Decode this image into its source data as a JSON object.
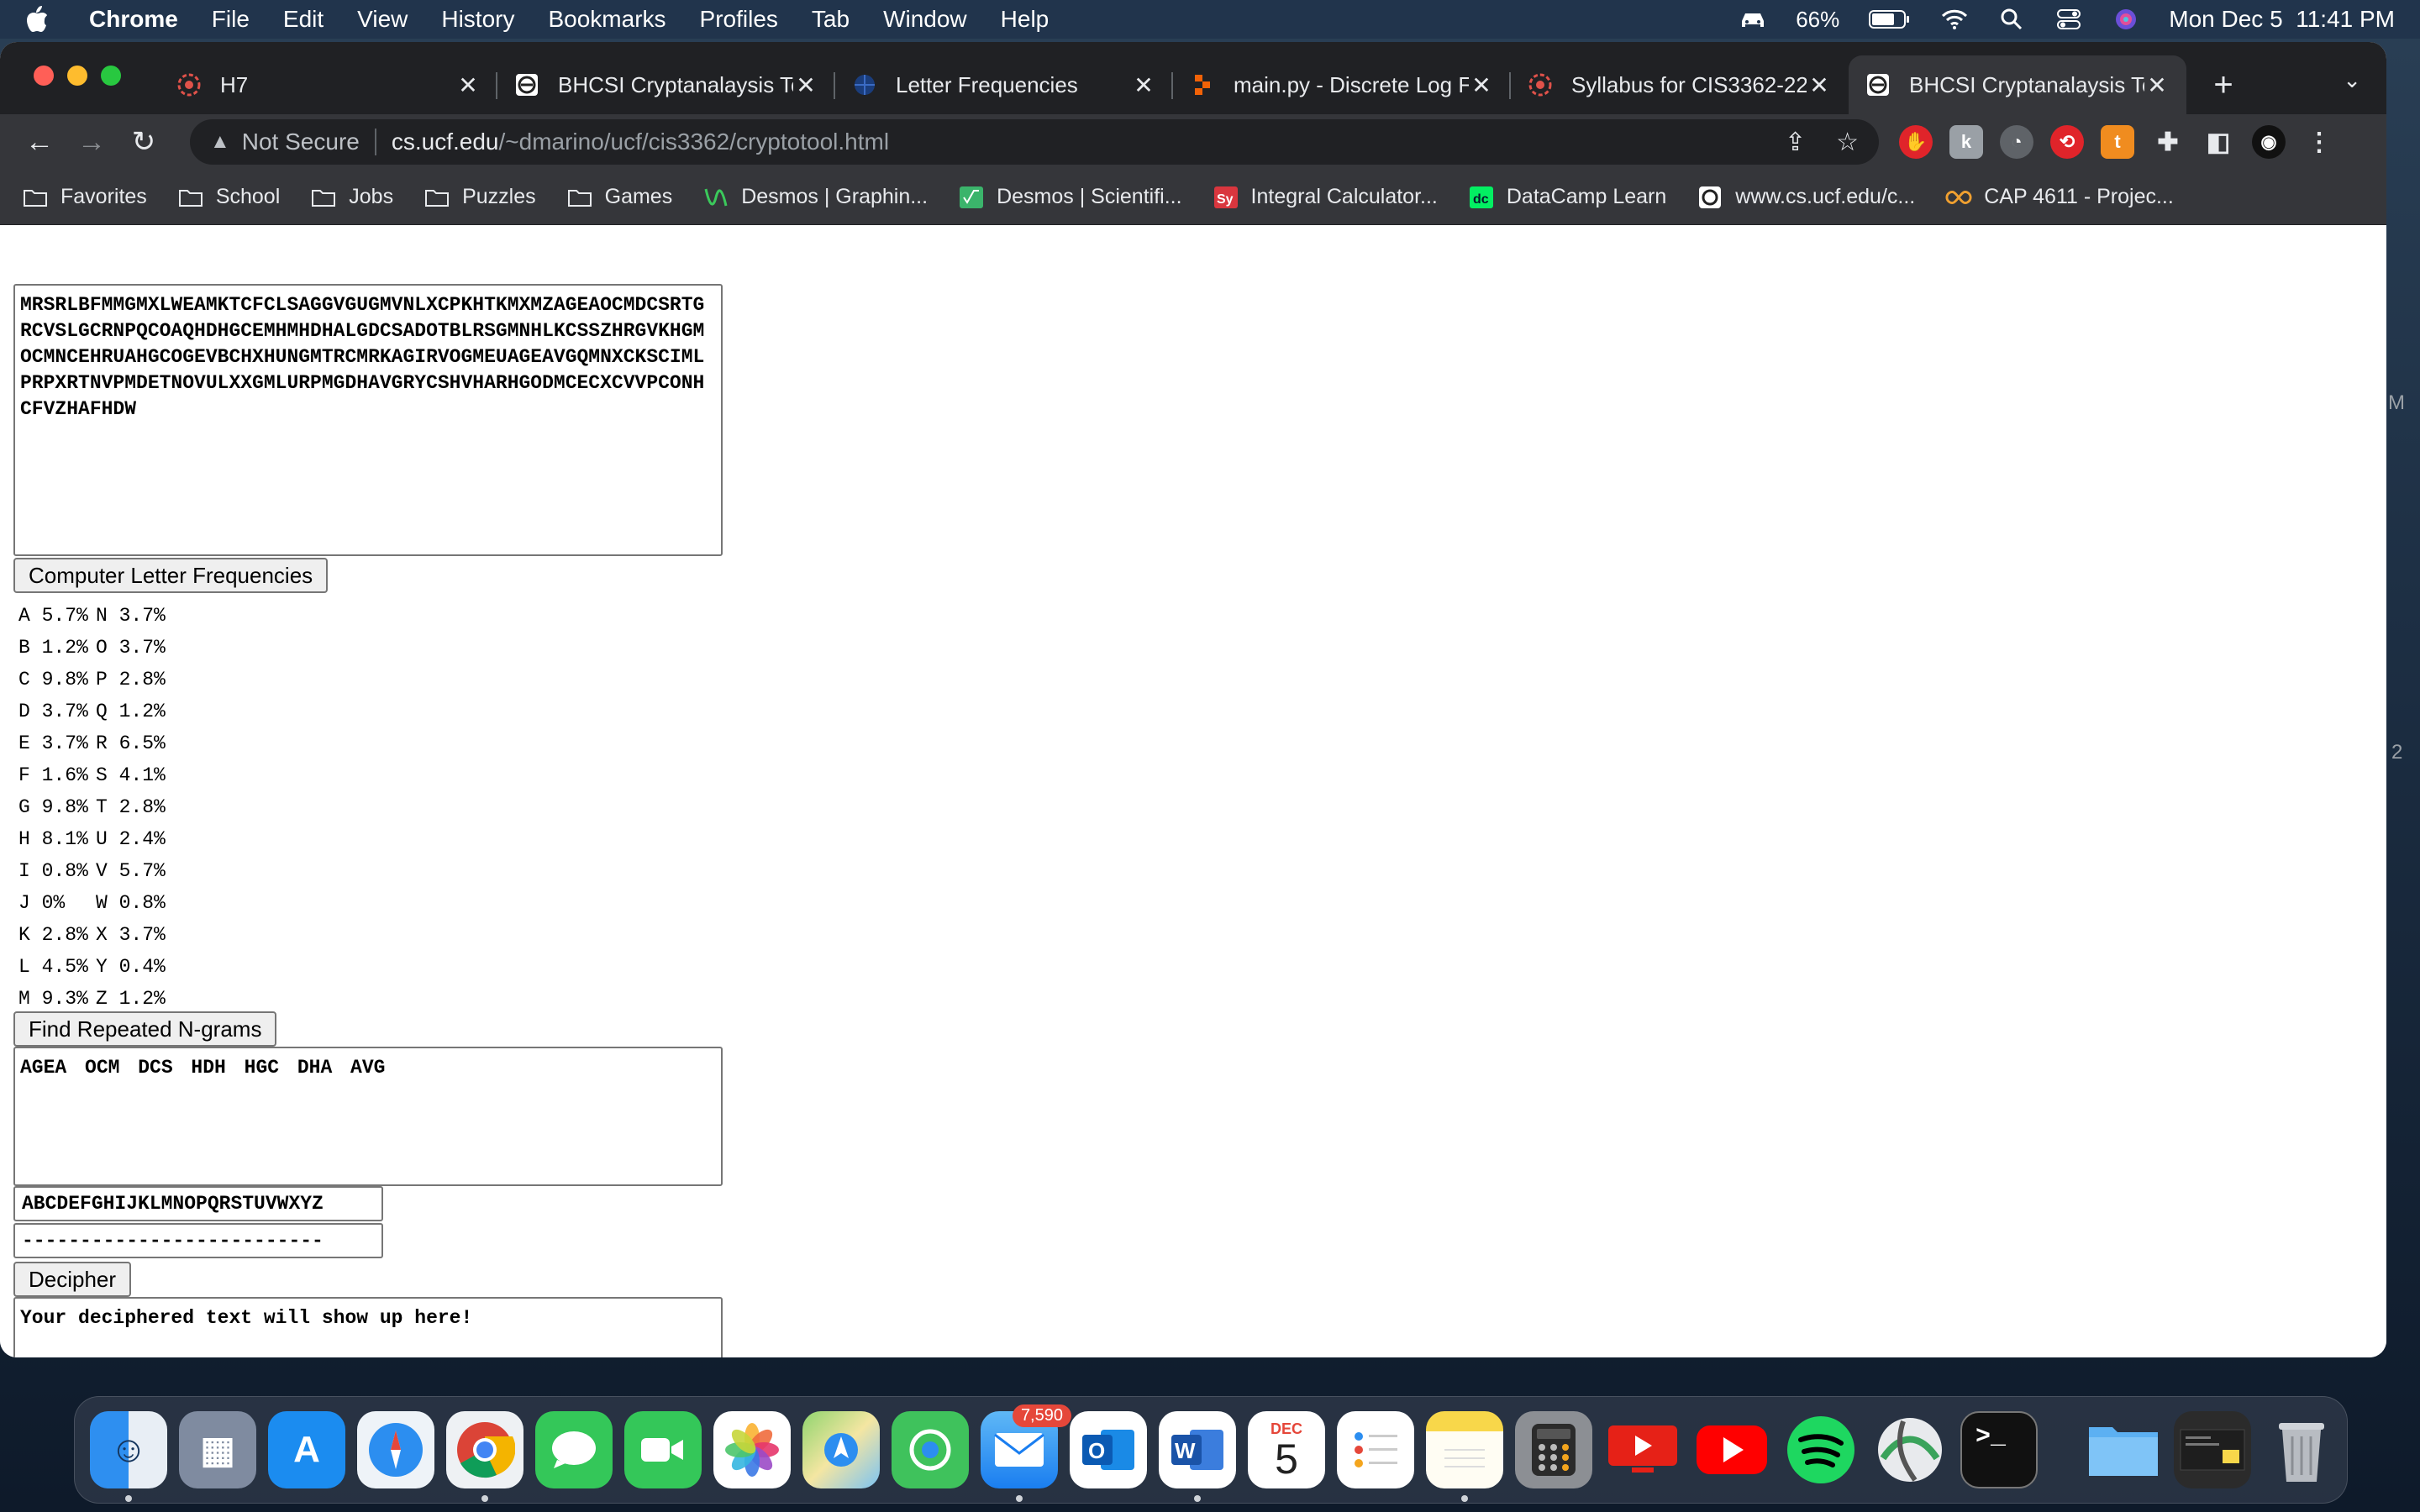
{
  "menubar": {
    "app_name": "Chrome",
    "items": [
      "File",
      "Edit",
      "View",
      "History",
      "Bookmarks",
      "Profiles",
      "Tab",
      "Window",
      "Help"
    ],
    "battery": "66%",
    "datetime": "Mon Dec 5  11:41 PM"
  },
  "tabs": [
    {
      "title": "H7",
      "icon": "ucf-icon"
    },
    {
      "title": "BHCSI Cryptanalaysis To",
      "icon": "cs-ucf-icon"
    },
    {
      "title": "Letter Frequencies",
      "icon": "globe-icon"
    },
    {
      "title": "main.py - Discrete Log F",
      "icon": "replit-icon"
    },
    {
      "title": "Syllabus for CIS3362-22",
      "icon": "ucf-icon"
    },
    {
      "title": "BHCSI Cryptanalaysis To",
      "icon": "cs-ucf-icon",
      "active": true
    }
  ],
  "omnibox": {
    "security": "Not Secure",
    "host": "cs.ucf.edu",
    "path": "/~dmarino/ucf/cis3362/cryptotool.html"
  },
  "bookmarks": [
    {
      "label": "Favorites",
      "icon": "folder-icon"
    },
    {
      "label": "School",
      "icon": "folder-icon"
    },
    {
      "label": "Jobs",
      "icon": "folder-icon"
    },
    {
      "label": "Puzzles",
      "icon": "folder-icon"
    },
    {
      "label": "Games",
      "icon": "folder-icon"
    },
    {
      "label": "Desmos | Graphin...",
      "icon": "desmos-graph-icon"
    },
    {
      "label": "Desmos | Scientifi...",
      "icon": "desmos-sci-icon"
    },
    {
      "label": "Integral Calculator...",
      "icon": "symbolab-icon"
    },
    {
      "label": "DataCamp Learn",
      "icon": "datacamp-icon"
    },
    {
      "label": "www.cs.ucf.edu/c...",
      "icon": "cs-ucf-icon"
    },
    {
      "label": "CAP 4611 - Projec...",
      "icon": "infinity-icon"
    }
  ],
  "tool": {
    "cipher_text": "MRSRLBFMMGMXLWEAMKTCFCLSAGGVGUGMVNLXCPKHTKMXMZAGEAOCMDCSRTGRCVSLGCRNPQCOAQHDHGCEMHMHDHALGDCSADOTBLRSGMNHLKCSSZHRGVKHGMOCMNCEHRUAHGCOGEVBCHXHUNGMTRCMRKAGIRVOGMEUAGEAVGQMNXCKSCIMLPRPXRTNVPMDETNOVULXXGMLURPMGDHAVGRYCSHVHARHGODMCECXCVVPCONHCFVZHAFHDW",
    "freq_button": "Computer Letter Frequencies",
    "frequencies": [
      [
        "A 5.7%",
        "N 3.7%"
      ],
      [
        "B 1.2%",
        "O 3.7%"
      ],
      [
        "C 9.8%",
        "P 2.8%"
      ],
      [
        "D 3.7%",
        "Q 1.2%"
      ],
      [
        "E 3.7%",
        "R 6.5%"
      ],
      [
        "F 1.6%",
        "S 4.1%"
      ],
      [
        "G 9.8%",
        "T 2.8%"
      ],
      [
        "H 8.1%",
        "U 2.4%"
      ],
      [
        "I 0.8%",
        "V 5.7%"
      ],
      [
        "J 0%",
        "W 0.8%"
      ],
      [
        "K 2.8%",
        "X 3.7%"
      ],
      [
        "L 4.5%",
        "Y 0.4%"
      ],
      [
        "M 9.3%",
        "Z 1.2%"
      ]
    ],
    "ngram_button": "Find Repeated N-grams",
    "ngram_output": "AGEA OCM DCS HDH HGC DHA AVG",
    "key_plain": "ABCDEFGHIJKLMNOPQRSTUVWXYZ",
    "key_cipher": "--------------------------",
    "decipher_button": "Decipher",
    "decipher_output": "Your deciphered text will show up here!"
  },
  "dock": {
    "mail_badge": "7,590",
    "calendar_month": "DEC",
    "calendar_day": "5",
    "apps": [
      "finder",
      "launchpad",
      "app-store",
      "safari",
      "chrome",
      "messages",
      "facetime",
      "photos",
      "maps",
      "find-my",
      "mail",
      "outlook",
      "word",
      "calendar",
      "reminders",
      "notes",
      "calculator",
      "youtube-studio",
      "youtube",
      "spotify",
      "network",
      "terminal",
      "folder",
      "screenshot",
      "trash"
    ]
  },
  "edge": {
    "m": "M",
    "two": "2"
  }
}
